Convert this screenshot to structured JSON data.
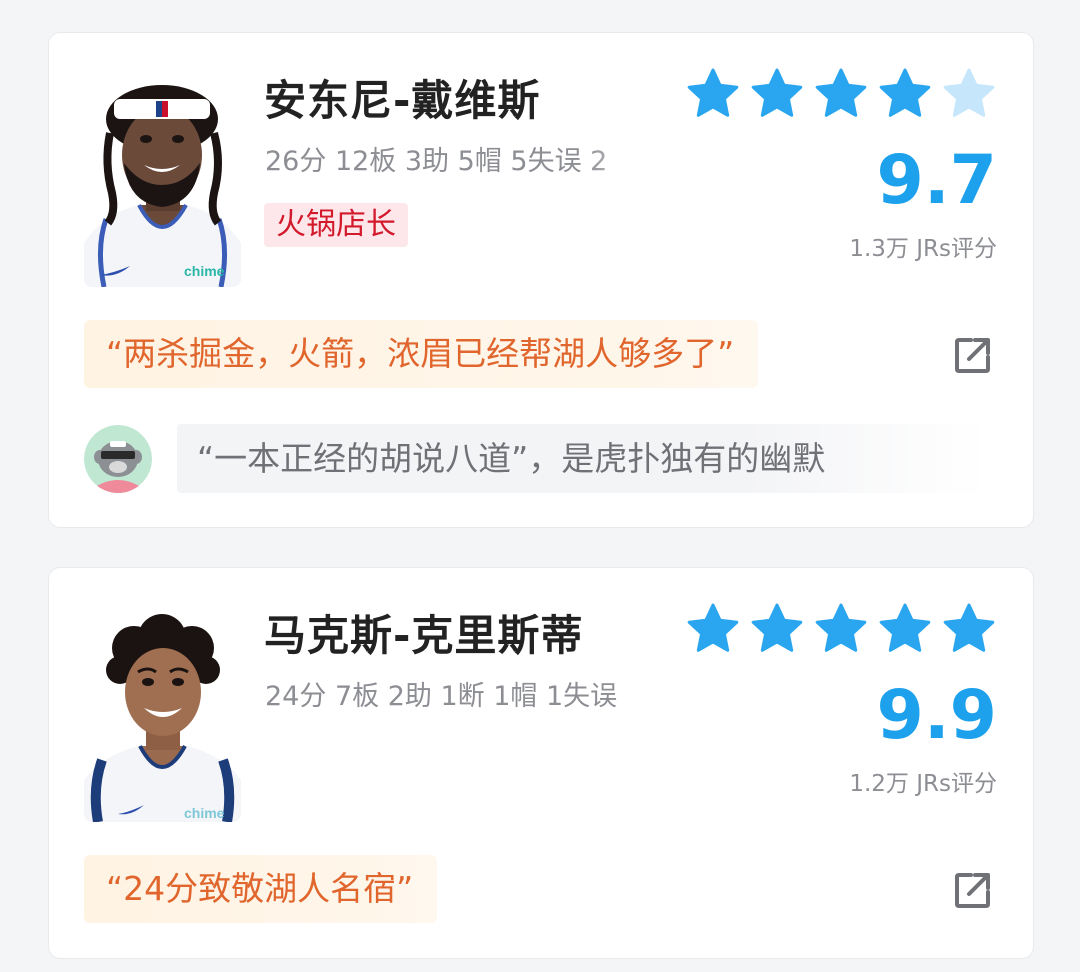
{
  "players": [
    {
      "name": "安东尼-戴维斯",
      "stats": "26分 12板 3助 5帽 5失误 2",
      "tag": "火锅店长",
      "rating": {
        "filled_stars": 4,
        "total_stars": 5
      },
      "score": "9.7",
      "votes": "1.3万 JRs评分",
      "quote": "“两杀掘金，火箭，浓眉已经帮湖人够多了”",
      "top_comment": "“一本正经的胡说八道”，是虎扑独有的幽默",
      "jersey_text": "chime"
    },
    {
      "name": "马克斯-克里斯蒂",
      "stats": "24分 7板 2助 1断 1帽 1失误",
      "rating": {
        "filled_stars": 5,
        "total_stars": 5
      },
      "score": "9.9",
      "votes": "1.2万 JRs评分",
      "quote": "“24分致敬湖人名宿”",
      "jersey_text": "chime"
    }
  ],
  "colors": {
    "accent": "#1da1ec",
    "star_filled": "#2aa6f0",
    "star_empty": "#c6e6fb",
    "quote_text": "#e0662d",
    "tag_text": "#d3192c",
    "tag_bg": "#fde7ea"
  },
  "icons": {
    "star": "star-icon",
    "share": "share-icon"
  }
}
